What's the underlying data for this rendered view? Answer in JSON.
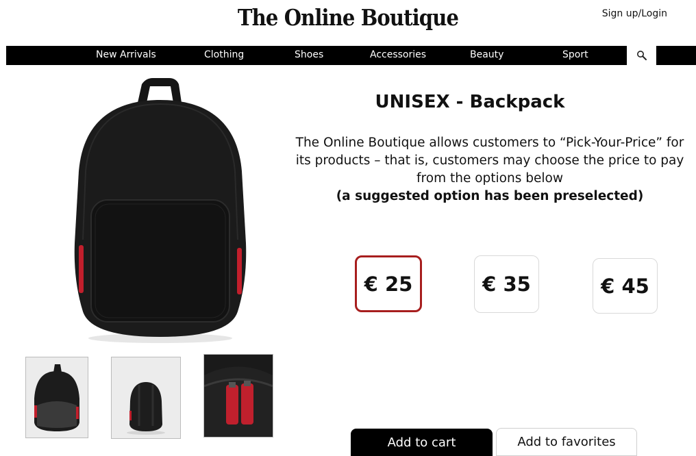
{
  "header": {
    "brand": "The Online Boutique",
    "login_label": "Sign up/Login"
  },
  "nav": {
    "items": [
      "New Arrivals",
      "Clothing",
      "Shoes",
      "Accessories",
      "Beauty",
      "Sport"
    ],
    "search_icon": "search-icon"
  },
  "product": {
    "title": "UNISEX - Backpack",
    "description": "The Online Boutique allows customers to “Pick-Your-Price” for its products – that is, customers may choose the price to pay from the options below",
    "note": "(a suggested option has been preselected)",
    "prices": [
      "€ 25",
      "€ 35",
      "€ 45"
    ],
    "selected_price": "€ 25",
    "selected_color": "#a71e1e"
  },
  "actions": {
    "add_to_cart": "Add to cart",
    "add_to_favorites": "Add to favorites"
  }
}
